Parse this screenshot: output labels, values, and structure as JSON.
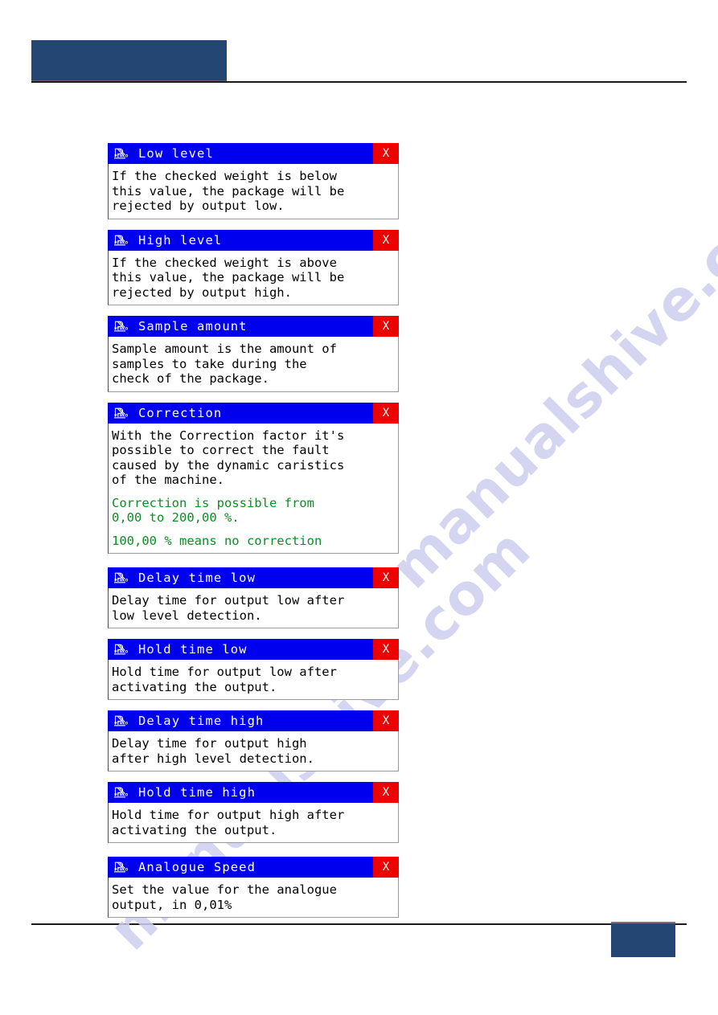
{
  "page": {
    "header": {
      "block_color": "#244673",
      "rule_color": "#1a1a1a",
      "accent_color": "#6b5b72"
    },
    "footer": {
      "block_color": "#244673",
      "rule_color": "#1a1a1a",
      "accent_color": "#8a6a72"
    },
    "watermark": {
      "line_1": "manualshive.com",
      "line_2": "manualshive.com",
      "color": "#cdd0ef"
    }
  },
  "theme": {
    "titlebar_color": "#0000ee",
    "close_button_color": "#ee0000",
    "body_color": "#ffffff",
    "text_color": "#000000",
    "highlight_text_color": "#0a8f22"
  },
  "common": {
    "close_label": "X",
    "icon_name": "penko-logo-icon"
  },
  "windows": [
    {
      "title": "Low level",
      "close": "X",
      "lines": [
        {
          "text": "If the checked weight is below",
          "style": "normal"
        },
        {
          "text": "this value, the package will be",
          "style": "normal"
        },
        {
          "text": "rejected by output low.",
          "style": "normal"
        }
      ],
      "gap_after": "normal"
    },
    {
      "title": "High level",
      "close": "X",
      "lines": [
        {
          "text": "If the checked weight is above",
          "style": "normal"
        },
        {
          "text": "this value, the package will be",
          "style": "normal"
        },
        {
          "text": "rejected by output high.",
          "style": "normal"
        }
      ],
      "gap_after": "normal"
    },
    {
      "title": "Sample amount",
      "close": "X",
      "lines": [
        {
          "text": "Sample amount is the amount of",
          "style": "normal"
        },
        {
          "text": "samples to take during the",
          "style": "normal"
        },
        {
          "text": "check of the package.",
          "style": "normal"
        }
      ],
      "gap_after": "normal"
    },
    {
      "title": "Correction",
      "close": "X",
      "lines": [
        {
          "text": "With the Correction factor it's",
          "style": "normal"
        },
        {
          "text": "possible to correct the fault",
          "style": "normal"
        },
        {
          "text": "caused by the dynamic caristics",
          "style": "normal"
        },
        {
          "text": "of the machine.",
          "style": "normal"
        },
        {
          "text": "",
          "style": "spacer"
        },
        {
          "text": "Correction is possible from",
          "style": "green"
        },
        {
          "text": "0,00 to 200,00 %.",
          "style": "green"
        },
        {
          "text": "",
          "style": "spacer"
        },
        {
          "text": "100,00 % means no correction",
          "style": "green"
        }
      ],
      "gap_after": "big"
    },
    {
      "title": "Delay time low",
      "close": "X",
      "lines": [
        {
          "text": "Delay time for output low after",
          "style": "normal"
        },
        {
          "text": "low level detection.",
          "style": "normal"
        }
      ],
      "gap_after": "normal"
    },
    {
      "title": "Hold time low",
      "close": "X",
      "lines": [
        {
          "text": "Hold time for output low after",
          "style": "normal"
        },
        {
          "text": "activating the output.",
          "style": "normal"
        }
      ],
      "gap_after": "normal"
    },
    {
      "title": "Delay time high",
      "close": "X",
      "lines": [
        {
          "text": "Delay time for output high",
          "style": "normal"
        },
        {
          "text": "after high level detection.",
          "style": "normal"
        }
      ],
      "gap_after": "normal"
    },
    {
      "title": "Hold time high",
      "close": "X",
      "lines": [
        {
          "text": "Hold time for output high after",
          "style": "normal"
        },
        {
          "text": "activating the output.",
          "style": "normal"
        }
      ],
      "gap_after": "big"
    },
    {
      "title": "Analogue Speed",
      "close": "X",
      "lines": [
        {
          "text": "Set the value for the analogue",
          "style": "normal"
        },
        {
          "text": "output, in 0,01%",
          "style": "normal"
        }
      ],
      "gap_after": "none"
    }
  ]
}
